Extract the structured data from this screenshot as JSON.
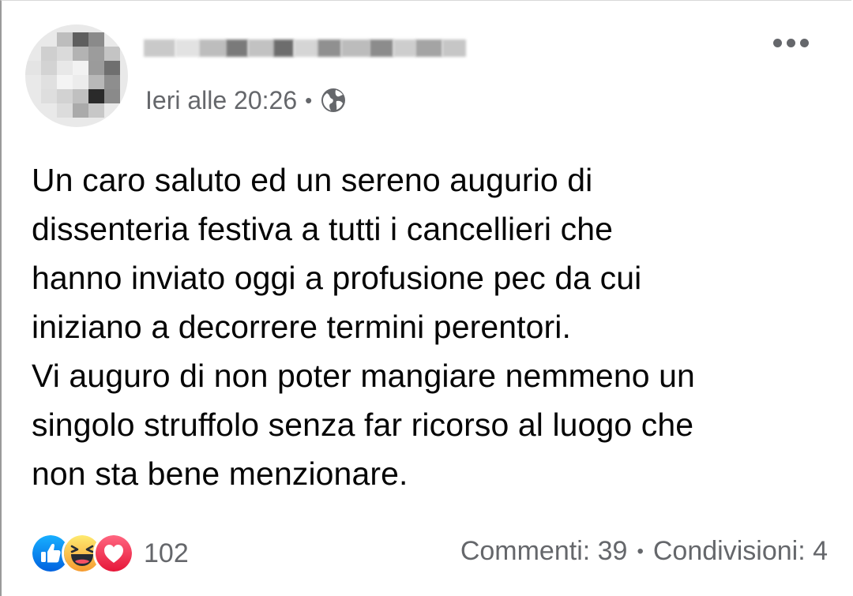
{
  "post": {
    "author_name": "",
    "timestamp": "Ieri alle 20:26",
    "separator": "•",
    "privacy_icon": "globe-icon",
    "more_icon": "more-options-icon",
    "text": "Un caro saluto ed un sereno augurio di\ndissenteria festiva a tutti i cancellieri che\nhanno inviato oggi a profusione pec da cui\niniziano a decorrere termini perentori.\nVi auguro di non poter mangiare nemmeno un\nsingolo struffolo senza far ricorso al luogo che\nnon sta bene menzionare."
  },
  "footer": {
    "reactions": [
      "like-icon",
      "haha-icon",
      "love-icon"
    ],
    "reaction_count": "102",
    "comments": "Commenti: 39",
    "stats_separator": "•",
    "shares": "Condivisioni: 4"
  },
  "colors": {
    "secondary_text": "#65676b",
    "like_blue": "#1877f2",
    "haha_yellow": "#f7b125",
    "love_red": "#f33e58"
  }
}
